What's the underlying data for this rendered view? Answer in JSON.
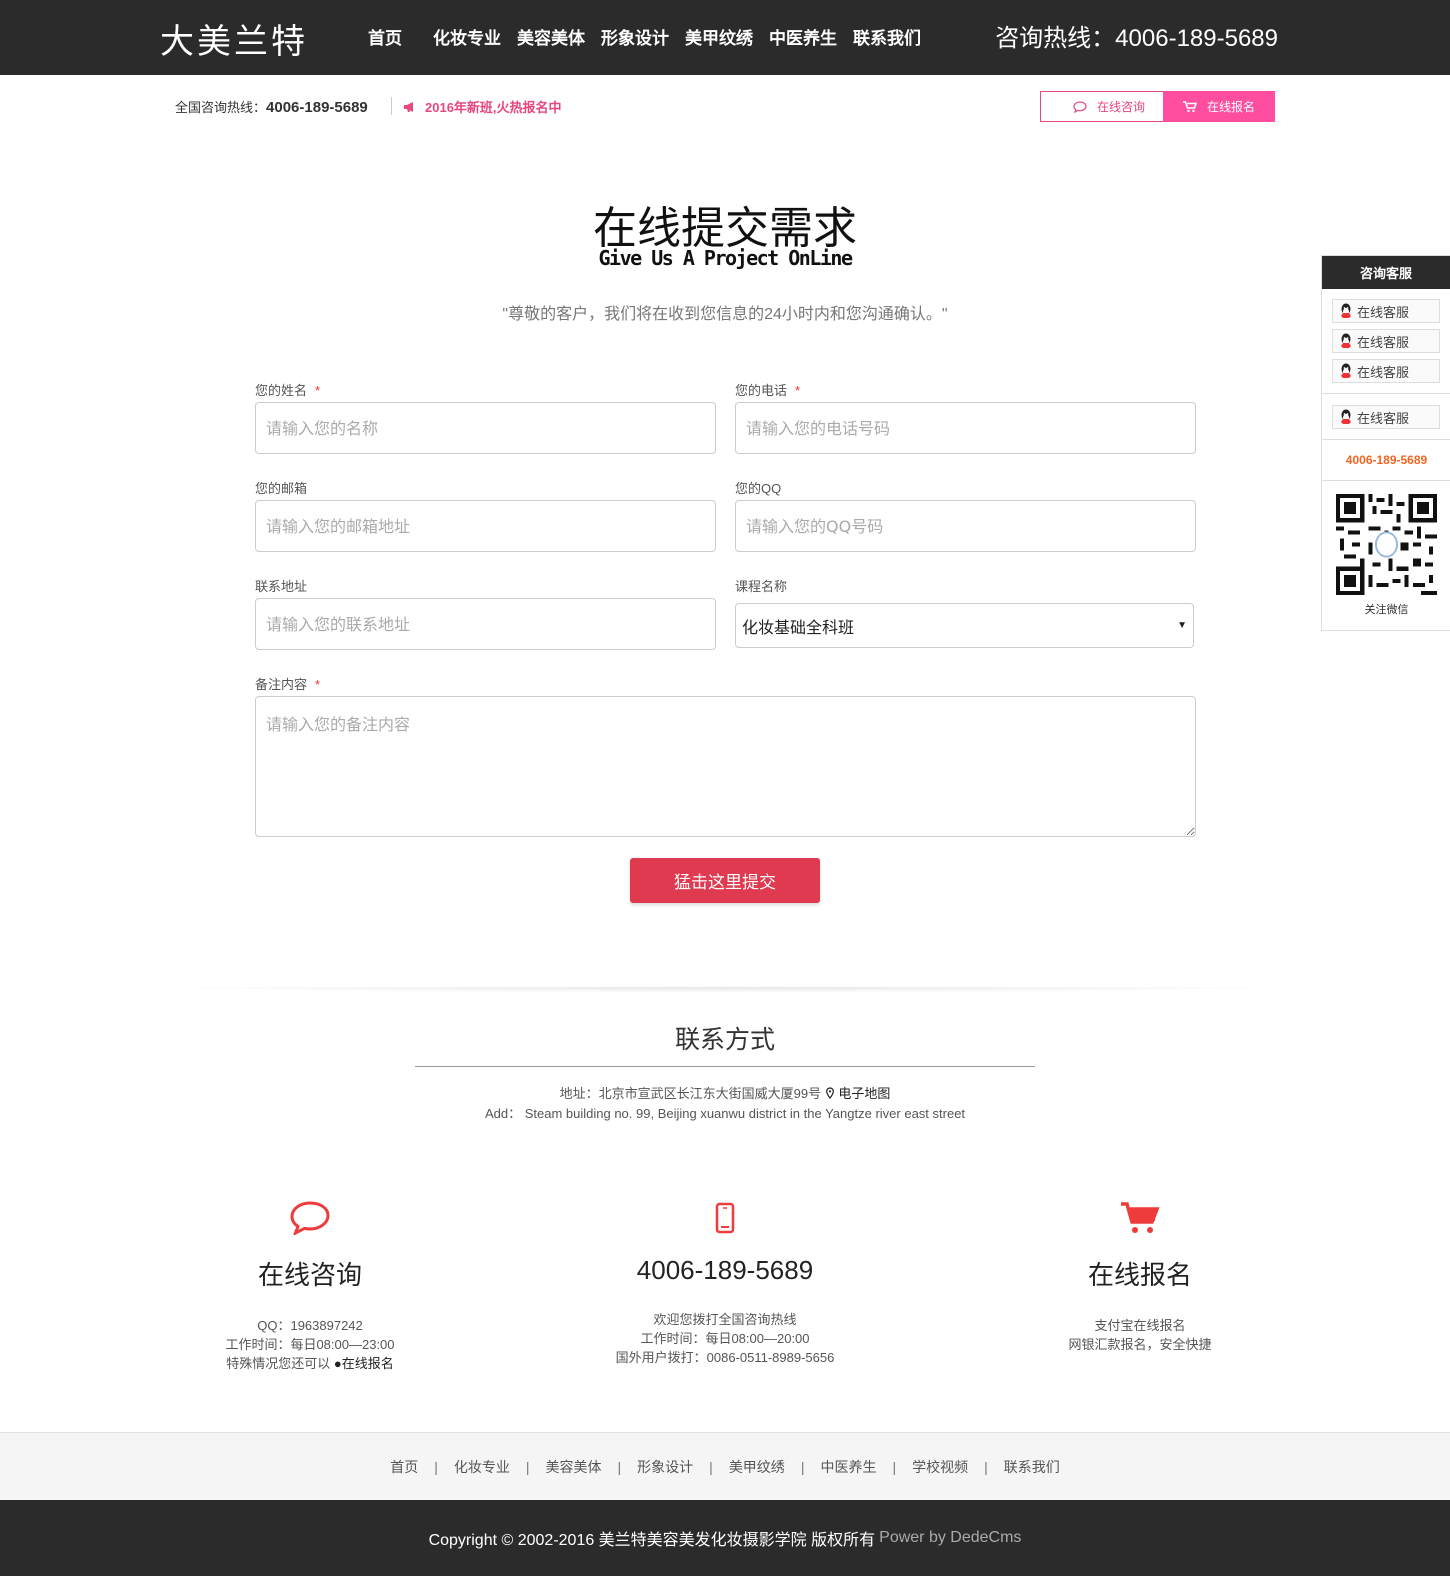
{
  "header": {
    "logo": "大美兰特",
    "nav": [
      "首页",
      "化妆专业",
      "美容美体",
      "形象设计",
      "美甲纹绣",
      "中医养生",
      "联系我们"
    ],
    "hotline": "咨询热线：4006-189-5689"
  },
  "subbar": {
    "phone_label": "全国咨询热线：",
    "phone_number": "4006-189-5689",
    "promo": "2016年新班,火热报名中",
    "consult_button": "在线咨询",
    "enroll_button": "在线报名",
    "accent_color": "#e8467f"
  },
  "form": {
    "title": "在线提交需求",
    "subtitle": "Give Us A Project OnLine",
    "description": "\"尊敬的客户，我们将在收到您信息的24小时内和您沟通确认。\"",
    "fields": {
      "name": {
        "label": "您的姓名",
        "required": "*",
        "placeholder": "请输入您的名称"
      },
      "phone": {
        "label": "您的电话",
        "required": "*",
        "placeholder": "请输入您的电话号码"
      },
      "email": {
        "label": "您的邮箱",
        "placeholder": "请输入您的邮箱地址"
      },
      "qq": {
        "label": "您的QQ",
        "placeholder": "请输入您的QQ号码"
      },
      "address": {
        "label": "联系地址",
        "placeholder": "请输入您的联系地址"
      },
      "course": {
        "label": "课程名称",
        "selected": "化妆基础全科班",
        "caret": "▼"
      },
      "note": {
        "label": "备注内容",
        "required": "*",
        "placeholder": "请输入您的备注内容"
      }
    },
    "submit": "猛击这里提交",
    "submit_color": "#df3a4f"
  },
  "contact": {
    "title": "联系方式",
    "address": "地址：北京市宣武区长江东大街国威大厦99号",
    "map_link": "电子地图",
    "address_en": "Add： Steam building no. 99, Beijing xuanwu district in the Yangtze river east street"
  },
  "columns": [
    {
      "icon": "chat-bubble-icon",
      "title": "在线咨询",
      "lines": [
        "QQ：1963897242",
        "工作时间：每日08:00—23:00"
      ],
      "extra_prefix": "特殊情况您还可以 ",
      "extra_link": "●在线报名"
    },
    {
      "icon": "mobile-phone-icon",
      "title": "4006-189-5689",
      "lines": [
        "欢迎您拨打全国咨询热线",
        "工作时间：每日08:00—20:00",
        "国外用户拨打：0086-0511-8989-5656"
      ]
    },
    {
      "icon": "shopping-cart-icon",
      "title": "在线报名",
      "lines": [
        "支付宝在线报名",
        "网银汇款报名，安全快捷"
      ]
    }
  ],
  "footer": {
    "links": [
      "首页",
      "化妆专业",
      "美容美体",
      "形象设计",
      "美甲纹绣",
      "中医养生",
      "学校视频",
      "联系我们"
    ],
    "separator": "|",
    "copyright": "Copyright © 2002-2016 美兰特美容美发化妆摄影学院 版权所有",
    "power": "Power by DedeCms"
  },
  "side_panel": {
    "title": "咨询客服",
    "items": [
      "在线客服",
      "在线客服",
      "在线客服",
      "在线客服"
    ],
    "phone": "4006-189-5689",
    "qr_label": "关注微信",
    "phone_color": "#f26522"
  }
}
